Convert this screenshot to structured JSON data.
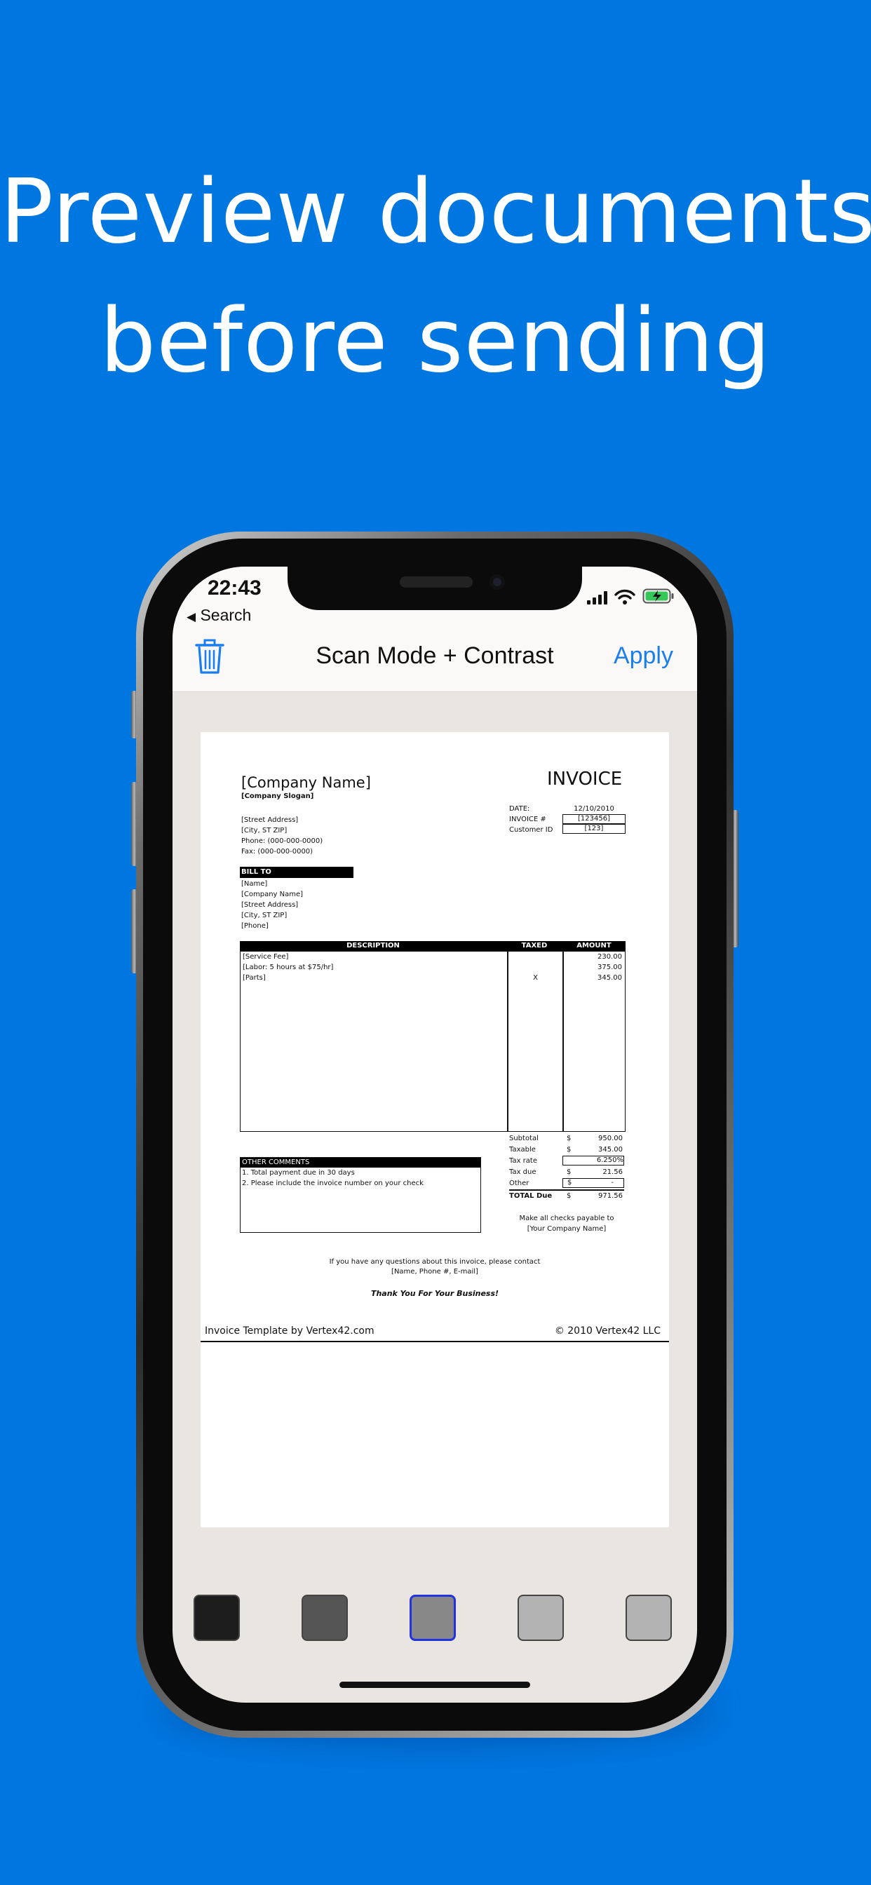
{
  "headline": {
    "line1": "Preview documents",
    "line2": "before sending"
  },
  "status_bar": {
    "time": "22:43",
    "back_label": "Search"
  },
  "nav": {
    "title": "Scan Mode + Contrast",
    "apply_label": "Apply",
    "delete_icon": "trash-icon"
  },
  "document": {
    "company_name": "[Company Name]",
    "company_slogan": "[Company Slogan]",
    "title": "INVOICE",
    "address_lines": [
      "[Street Address]",
      "[City, ST  ZIP]",
      "Phone: (000-000-0000)",
      "Fax: (000-000-0000)"
    ],
    "meta": [
      {
        "label": "DATE:",
        "value": "12/10/2010"
      },
      {
        "label": "INVOICE #",
        "value": "[123456]"
      },
      {
        "label": "Customer ID",
        "value": "[123]"
      }
    ],
    "bill_to_label": "BILL TO",
    "bill_to_lines": [
      "[Name]",
      "[Company Name]",
      "[Street Address]",
      "[City, ST  ZIP]",
      "[Phone]"
    ],
    "table_headers": {
      "description": "DESCRIPTION",
      "taxed": "TAXED",
      "amount": "AMOUNT"
    },
    "items": [
      {
        "description": "[Service Fee]",
        "taxed": "",
        "amount": "230.00"
      },
      {
        "description": "[Labor: 5 hours at $75/hr]",
        "taxed": "",
        "amount": "375.00"
      },
      {
        "description": "[Parts]",
        "taxed": "X",
        "amount": "345.00"
      }
    ],
    "totals": [
      {
        "label": "Subtotal",
        "currency": "$",
        "value": "950.00"
      },
      {
        "label": "Taxable",
        "currency": "$",
        "value": "345.00"
      },
      {
        "label": "Tax rate",
        "currency": "",
        "value": "6.250%"
      },
      {
        "label": "Tax due",
        "currency": "$",
        "value": "21.56"
      },
      {
        "label": "Other",
        "currency": "$",
        "value": "-"
      },
      {
        "label": "TOTAL Due",
        "currency": "$",
        "value": "971.56"
      }
    ],
    "comments_label": "OTHER COMMENTS",
    "comments": [
      "1. Total payment due in 30 days",
      "2. Please include the invoice number on your check"
    ],
    "payable_line1": "Make all checks payable to",
    "payable_line2": "[Your Company Name]",
    "contact_line1": "If you have any questions about this invoice, please contact",
    "contact_line2": "[Name, Phone #, E-mail]",
    "thanks": "Thank You For Your Business!",
    "footer_left": "Invoice Template by Vertex42.com",
    "footer_right": "© 2010 Vertex42 LLC"
  },
  "filters": [
    {
      "name": "black",
      "color": "#1d1d1d",
      "selected": false
    },
    {
      "name": "dark-gray",
      "color": "#555555",
      "selected": false
    },
    {
      "name": "gray",
      "color": "#888888",
      "selected": true
    },
    {
      "name": "light-gray",
      "color": "#b3b3b3",
      "selected": false
    },
    {
      "name": "silver",
      "color": "#b3b3b3",
      "selected": false
    }
  ],
  "colors": {
    "background": "#0077e0",
    "accent": "#1a7ef0",
    "selection": "#2233dd"
  }
}
